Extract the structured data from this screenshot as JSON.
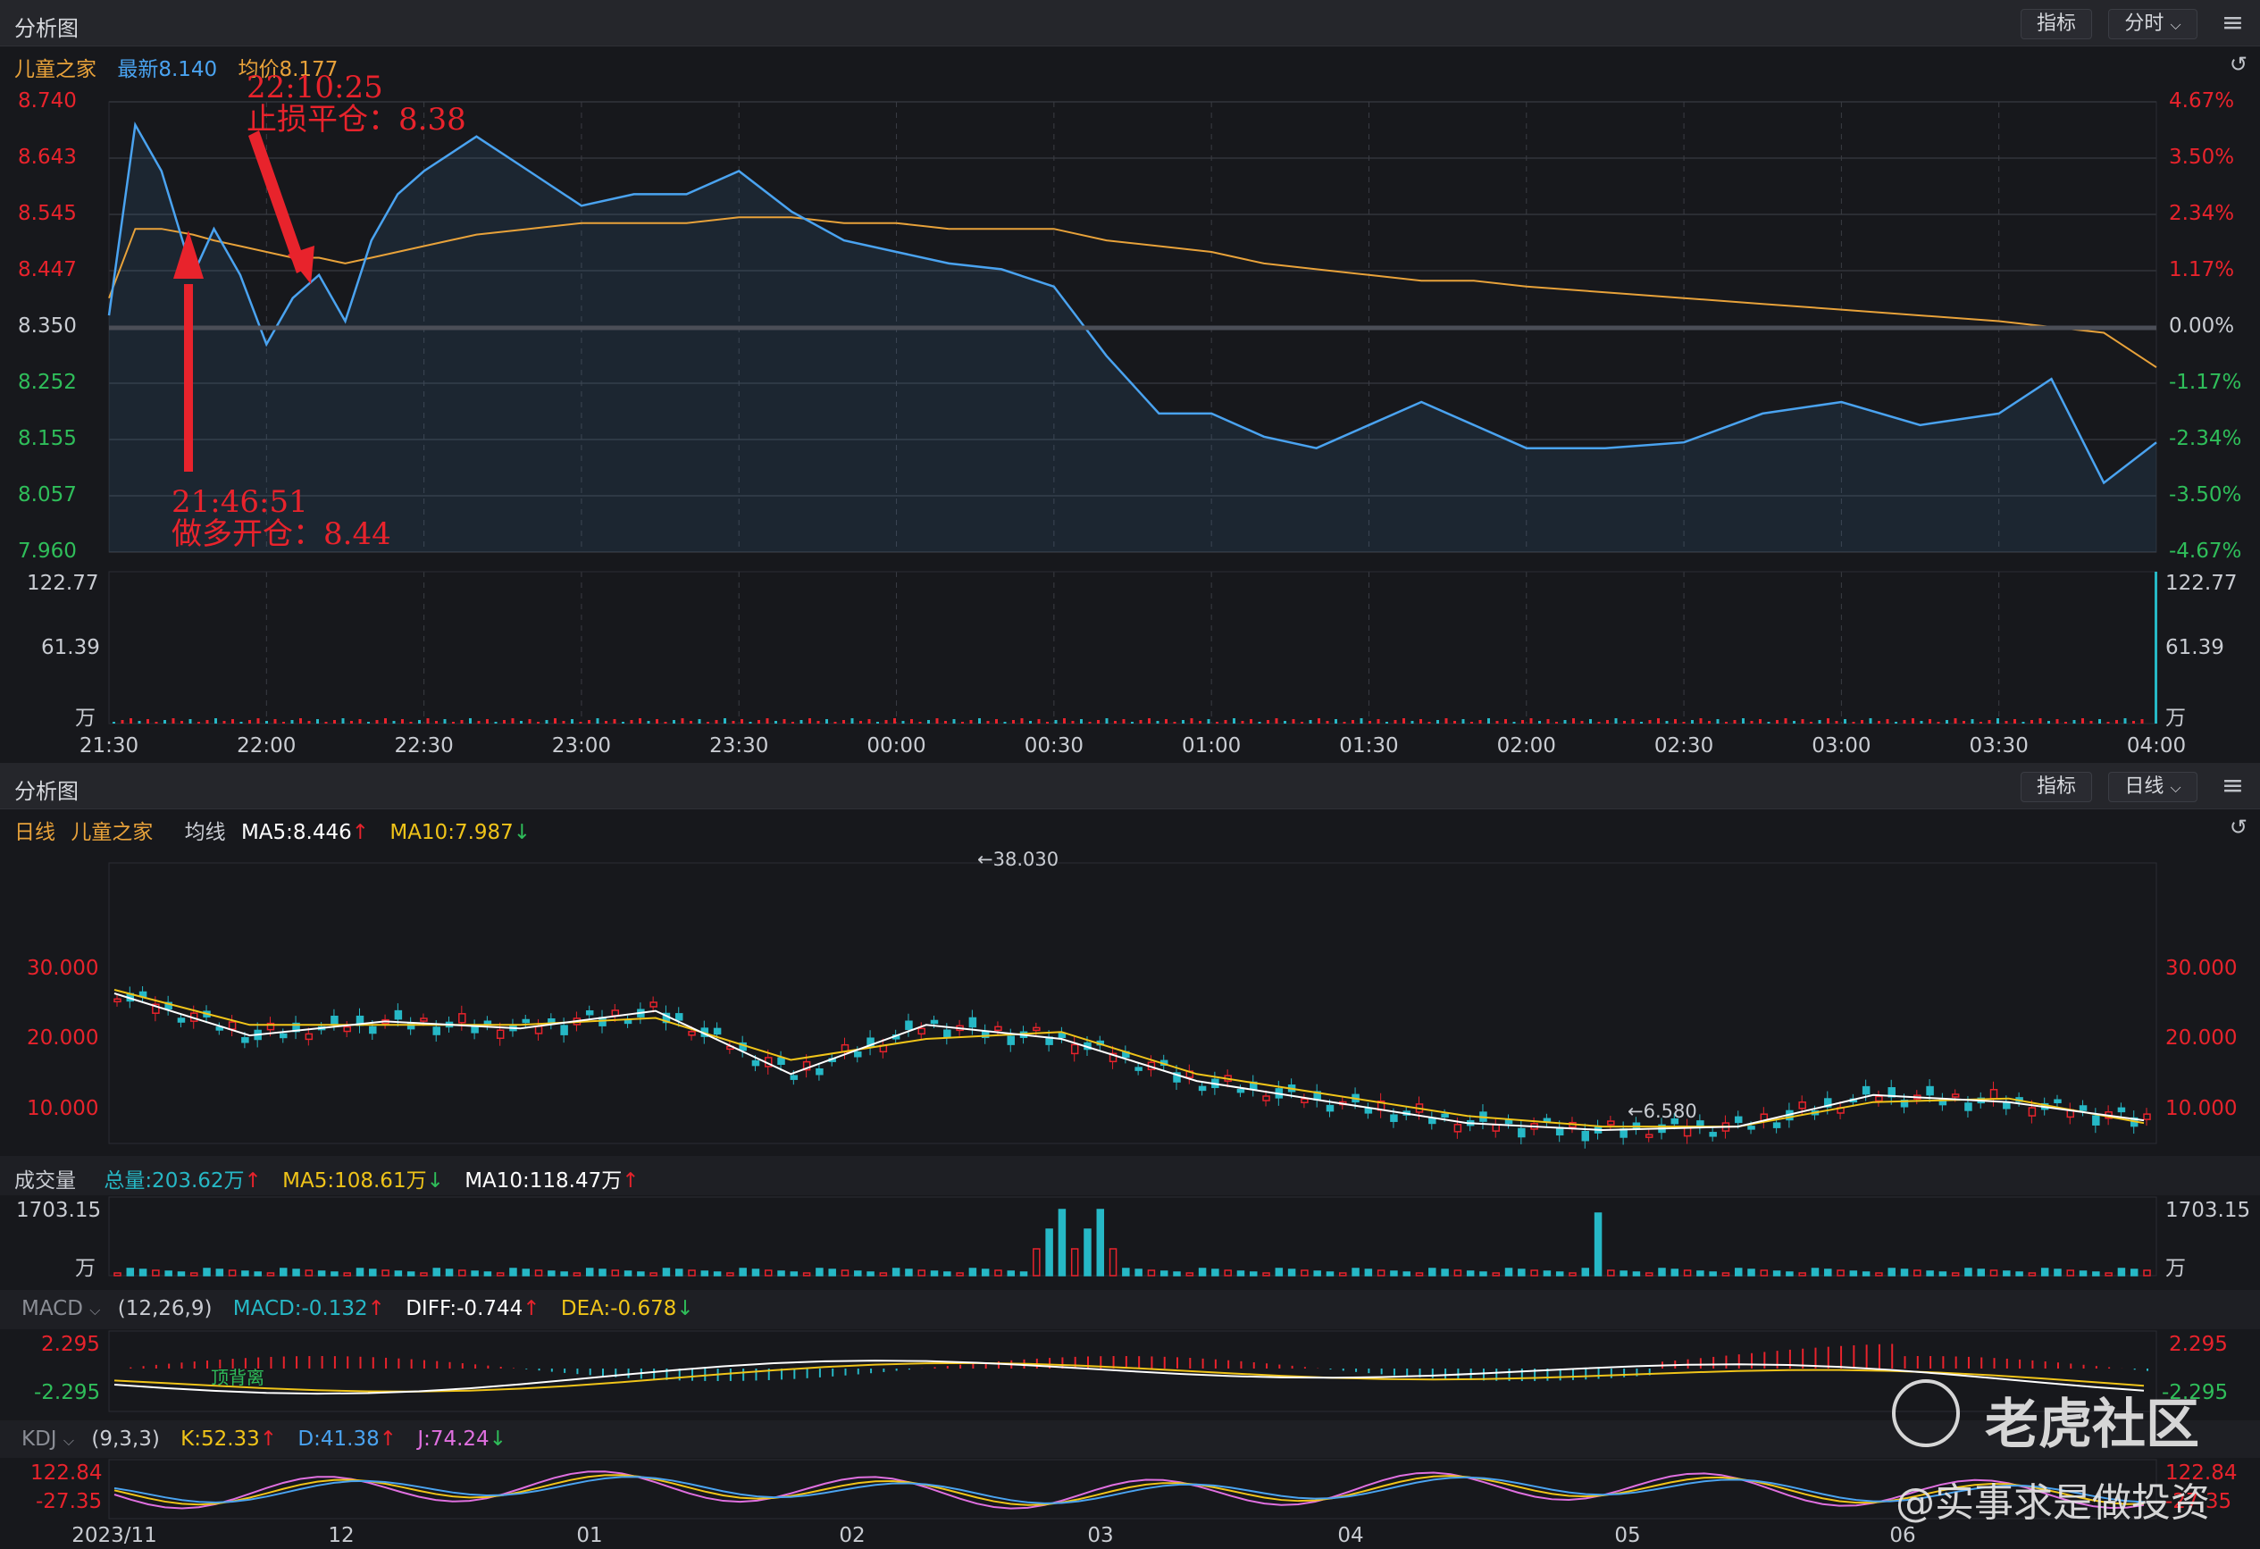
{
  "top_panel": {
    "title": "分析图",
    "indicator_btn": "指标",
    "period_btn": "分时",
    "stock_name": "儿童之家",
    "latest": "最新8.140",
    "avg": "均价8.177",
    "price_ticks_left": [
      "8.740",
      "8.643",
      "8.545",
      "8.447",
      "8.350",
      "8.252",
      "8.155",
      "8.057",
      "7.960"
    ],
    "pct_ticks_right": [
      "4.67%",
      "3.50%",
      "2.34%",
      "1.17%",
      "0.00%",
      "-1.17%",
      "-2.34%",
      "-3.50%",
      "-4.67%"
    ],
    "vol_ticks": [
      "122.77",
      "61.39",
      "万"
    ],
    "time_ticks": [
      "21:30",
      "22:00",
      "22:30",
      "23:00",
      "23:30",
      "00:00",
      "00:30",
      "01:00",
      "01:30",
      "02:00",
      "02:30",
      "03:00",
      "03:30",
      "04:00"
    ],
    "annotation_stop": {
      "time": "22:10:25",
      "text": "止损平仓：8.38"
    },
    "annotation_open": {
      "time": "21:46:51",
      "text": "做多开仓：8.44"
    }
  },
  "bottom_panel": {
    "title": "分析图",
    "indicator_btn": "指标",
    "period_btn": "日线",
    "period": "日线",
    "stock_name": "儿童之家",
    "ma_label": "均线",
    "ma5": "MA5:8.446",
    "ma10": "MA10:7.987",
    "price_ticks": [
      "30.000",
      "20.000",
      "10.000"
    ],
    "high_mark": "←38.030",
    "low_mark": "←6.580",
    "volume": {
      "label": "成交量",
      "total": "总量:203.62万",
      "ma5": "MA5:108.61万",
      "ma10": "MA10:118.47万",
      "ticks": [
        "1703.15",
        "万"
      ]
    },
    "macd": {
      "label": "MACD",
      "params": "(12,26,9)",
      "macd": "MACD:-0.132",
      "diff": "DIFF:-0.744",
      "dea": "DEA:-0.678",
      "ticks": [
        "2.295",
        "-2.295"
      ],
      "note": "顶背离"
    },
    "kdj": {
      "label": "KDJ",
      "params": "(9,3,3)",
      "k": "K:52.33",
      "d": "D:41.38",
      "j": "J:74.24",
      "ticks": [
        "122.84",
        "-27.35"
      ]
    },
    "date_ticks": [
      "2023/11",
      "12",
      "01",
      "02",
      "03",
      "04",
      "05",
      "06"
    ]
  },
  "watermark": {
    "brand": "老虎社区",
    "handle": "@实事求是做投资"
  },
  "chart_data": [
    {
      "type": "line",
      "title": "儿童之家",
      "x": [
        "21:30",
        "21:35",
        "21:40",
        "21:46",
        "21:50",
        "21:55",
        "22:00",
        "22:05",
        "22:10",
        "22:15",
        "22:20",
        "22:25",
        "22:30",
        "22:40",
        "22:50",
        "23:00",
        "23:10",
        "23:20",
        "23:30",
        "23:40",
        "23:50",
        "00:00",
        "00:10",
        "00:20",
        "00:30",
        "00:40",
        "00:50",
        "01:00",
        "01:10",
        "01:20",
        "01:30",
        "01:40",
        "01:50",
        "02:00",
        "02:15",
        "02:30",
        "02:45",
        "03:00",
        "03:15",
        "03:30",
        "03:40",
        "03:50",
        "04:00"
      ],
      "series": [
        {
          "name": "最新",
          "values": [
            8.37,
            8.7,
            8.62,
            8.44,
            8.52,
            8.44,
            8.32,
            8.4,
            8.44,
            8.36,
            8.5,
            8.58,
            8.62,
            8.68,
            8.62,
            8.56,
            8.58,
            8.58,
            8.62,
            8.55,
            8.5,
            8.48,
            8.46,
            8.45,
            8.42,
            8.3,
            8.2,
            8.2,
            8.16,
            8.14,
            8.18,
            8.22,
            8.18,
            8.14,
            8.14,
            8.15,
            8.2,
            8.22,
            8.18,
            8.2,
            8.26,
            8.08,
            8.15
          ]
        },
        {
          "name": "均价",
          "values": [
            8.4,
            8.52,
            8.52,
            8.51,
            8.5,
            8.49,
            8.48,
            8.47,
            8.47,
            8.46,
            8.47,
            8.48,
            8.49,
            8.51,
            8.52,
            8.53,
            8.53,
            8.53,
            8.54,
            8.54,
            8.53,
            8.53,
            8.52,
            8.52,
            8.52,
            8.5,
            8.49,
            8.48,
            8.46,
            8.45,
            8.44,
            8.43,
            8.43,
            8.42,
            8.41,
            8.4,
            8.39,
            8.38,
            8.37,
            8.36,
            8.35,
            8.34,
            8.28
          ]
        }
      ],
      "ylim": [
        7.96,
        8.74
      ]
    },
    {
      "type": "line",
      "title": "日线",
      "x": [
        "2023/11",
        "12",
        "01",
        "02",
        "03",
        "04",
        "05",
        "06"
      ],
      "series": [
        {
          "name": "MA5",
          "values": [
            26.5,
            20.5,
            22.5,
            21.5,
            24,
            15,
            22,
            20,
            14,
            11,
            8,
            7,
            7.5,
            12,
            11,
            8.4
          ]
        },
        {
          "name": "MA10",
          "values": [
            27,
            22,
            22,
            22,
            23,
            17,
            20,
            21,
            15,
            12,
            9,
            7.5,
            7.5,
            11,
            11.5,
            8
          ]
        }
      ],
      "ylim": [
        0,
        40
      ]
    }
  ]
}
